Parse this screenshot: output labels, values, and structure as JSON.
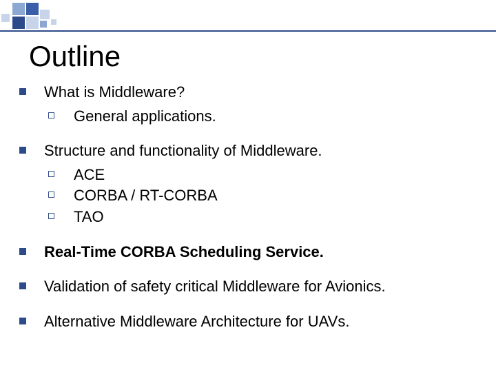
{
  "slide": {
    "title": "Outline",
    "items": [
      {
        "text": "What is Middleware?",
        "bold": false,
        "children": [
          {
            "text": "General applications."
          }
        ]
      },
      {
        "text": "Structure and functionality of Middleware.",
        "bold": false,
        "children": [
          {
            "text": "ACE"
          },
          {
            "text": "CORBA / RT-CORBA"
          },
          {
            "text": "TAO"
          }
        ]
      },
      {
        "text": "Real-Time CORBA Scheduling Service.",
        "bold": true,
        "children": []
      },
      {
        "text": "Validation of safety critical Middleware for Avionics.",
        "bold": false,
        "children": []
      },
      {
        "text": "Alternative Middleware Architecture for UAVs.",
        "bold": false,
        "children": []
      }
    ]
  }
}
